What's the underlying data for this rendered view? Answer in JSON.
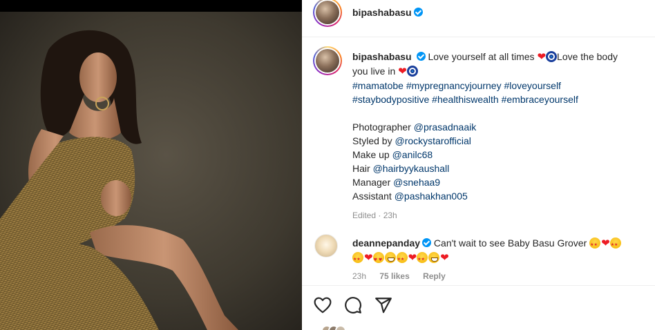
{
  "post": {
    "username": "bipashabasu",
    "image_alt": "Photo shared by bipashabasu"
  },
  "caption": {
    "username": "bipashabasu",
    "line1_a": "Love yourself at all times",
    "line1_b": "Love the body",
    "line2": "you live in",
    "hashtags_line1": "#mamatobe #mypregnancyjourney #loveyourself",
    "hashtags_line2": "#staybodypositive #healthiswealth #embraceyourself",
    "credits": [
      {
        "label": "Photographer",
        "handle": "@prasadnaaik"
      },
      {
        "label": "Styled by",
        "handle": "@rockystarofficial"
      },
      {
        "label": "Make up",
        "handle": "@anilc68"
      },
      {
        "label": "Hair",
        "handle": "@hairbyykaushall"
      },
      {
        "label": "Manager",
        "handle": "@snehaa9"
      },
      {
        "label": "Assistant",
        "handle": "@pashakhan005"
      }
    ],
    "meta": "Edited · 23h"
  },
  "comment": {
    "username": "deannepanday",
    "text": "Can't wait to see Baby Basu Grover",
    "time": "23h",
    "likes": "75 likes",
    "reply": "Reply"
  },
  "actions": {
    "like_icon": "heart-outline-icon",
    "comment_icon": "comment-bubble-icon",
    "share_icon": "paper-plane-icon"
  },
  "colors": {
    "link": "#00376b",
    "verified": "#0095f6",
    "muted": "#8e8e8e"
  }
}
